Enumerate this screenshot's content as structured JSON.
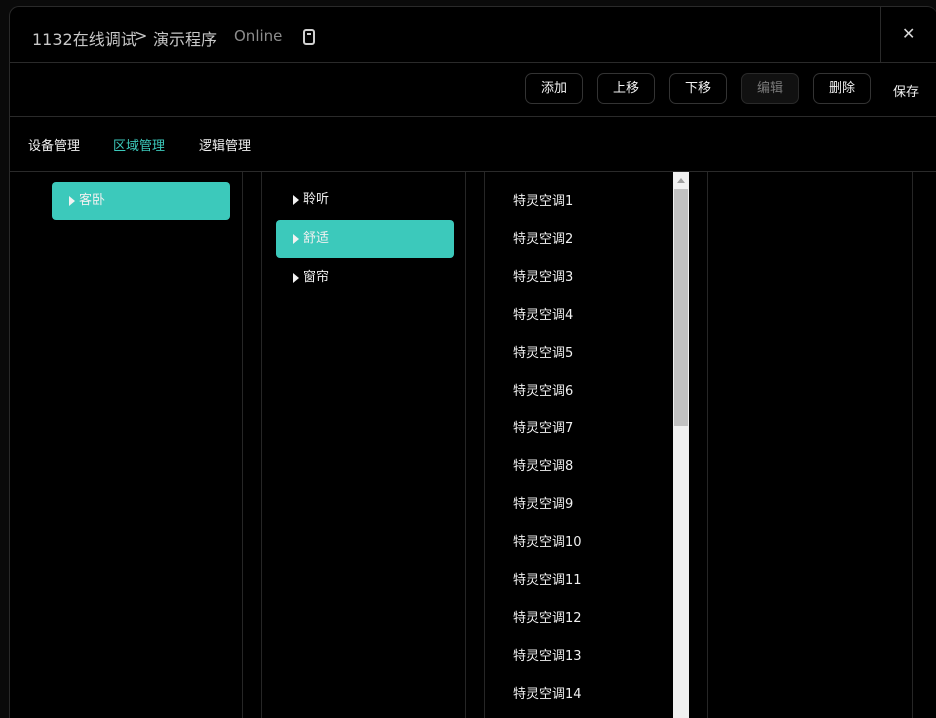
{
  "header": {
    "breadcrumb_root": "1132在线调试",
    "breadcrumb_sep": ">",
    "breadcrumb_current": "演示程序",
    "status": "Online",
    "device_icon": "tablet-icon",
    "close_icon": "close-icon",
    "close_glyph": "✕"
  },
  "toolbar": {
    "add": "添加",
    "move_up": "上移",
    "move_down": "下移",
    "edit": "编辑",
    "delete": "删除",
    "save": "保存"
  },
  "tabs": [
    {
      "label": "设备管理",
      "active": false
    },
    {
      "label": "区域管理",
      "active": true
    },
    {
      "label": "逻辑管理",
      "active": false
    }
  ],
  "rooms": [
    {
      "label": "客卧",
      "selected": true
    }
  ],
  "scenes": [
    {
      "label": "聆听",
      "selected": false
    },
    {
      "label": "舒适",
      "selected": true
    },
    {
      "label": "窗帘",
      "selected": false
    }
  ],
  "devices": [
    "特灵空调1",
    "特灵空调2",
    "特灵空调3",
    "特灵空调4",
    "特灵空调5",
    "特灵空调6",
    "特灵空调7",
    "特灵空调8",
    "特灵空调9",
    "特灵空调10",
    "特灵空调11",
    "特灵空调12",
    "特灵空调13",
    "特灵空调14"
  ],
  "colors": {
    "accent": "#3cc9bb",
    "background": "#000000",
    "border": "#2a2a2a"
  }
}
